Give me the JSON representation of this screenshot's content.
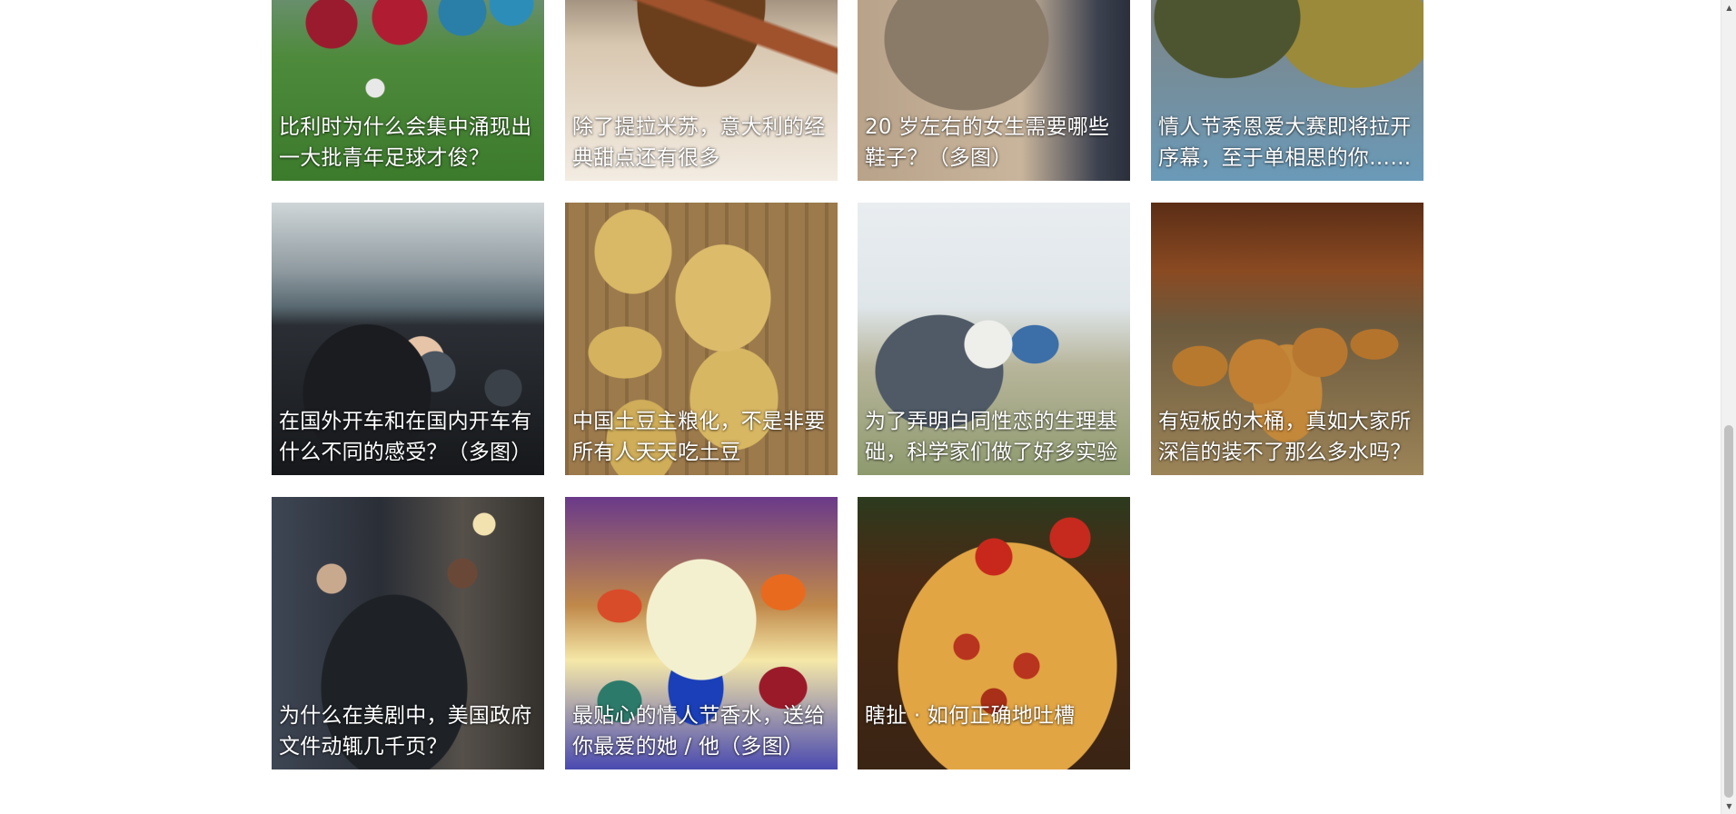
{
  "articles": [
    {
      "title_line1": "比利时为什么会集中涌现出",
      "title_line2": "一大批青年足球才俊？",
      "image": "youth-football-photo"
    },
    {
      "title_line1": "除了提拉米苏，意大利的经",
      "title_line2": "典甜点还有很多",
      "image": "tiramisu-photo"
    },
    {
      "title_line1": "20 岁左右的女生需要哪些",
      "title_line2": "鞋子？（多图）",
      "image": "high-heels-photo"
    },
    {
      "title_line1": "情人节秀恩爱大赛即将拉开",
      "title_line2": "序幕，至于单相思的你……",
      "image": "couple-photo"
    },
    {
      "title_line1": "在国外开车和在国内开车有",
      "title_line2": "什么不同的感受？（多图）",
      "image": "driving-photo"
    },
    {
      "title_line1": "中国土豆主粮化，不是非要",
      "title_line2": "所有人天天吃土豆",
      "image": "potatoes-photo"
    },
    {
      "title_line1": "为了弄明白同性恋的生理基",
      "title_line2": "础，科学家们做了好多实验",
      "image": "cowboys-truck-photo"
    },
    {
      "title_line1": "有短板的木桶，真如大家所",
      "title_line2": "深信的装不了那么多水吗？",
      "image": "wine-barrels-photo"
    },
    {
      "title_line1": "为什么在美剧中，美国政府",
      "title_line2": "文件动辄几千页？",
      "image": "tv-drama-office-photo"
    },
    {
      "title_line1": "最贴心的情人节香水，送给",
      "title_line2": "你最爱的她 / 他（多图）",
      "image": "perfume-bottles-photo"
    },
    {
      "title_line1": "瞎扯 · 如何正确地吐槽",
      "title_line2": "",
      "image": "pizza-photo"
    }
  ],
  "scrollbar": {
    "up_arrow": "▲",
    "down_arrow": "▼"
  }
}
